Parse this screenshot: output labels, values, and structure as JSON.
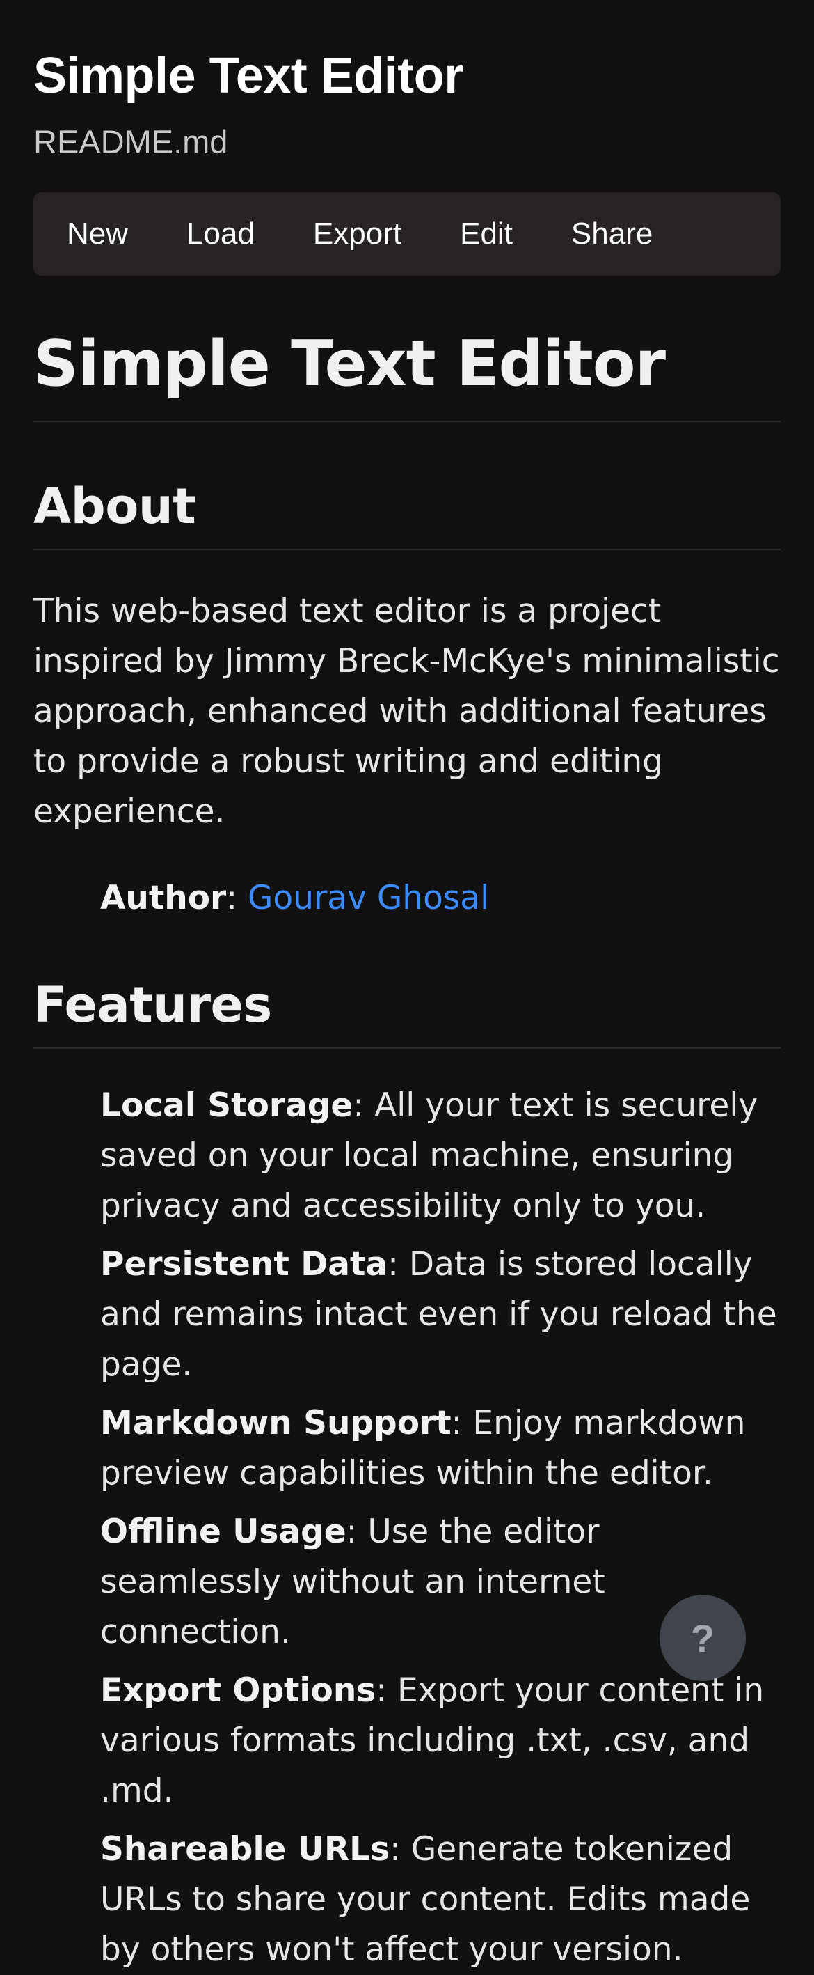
{
  "app": {
    "title": "Simple Text Editor",
    "filename": "README.md"
  },
  "toolbar": {
    "items": [
      {
        "label": "New"
      },
      {
        "label": "Load"
      },
      {
        "label": "Export"
      },
      {
        "label": "Edit"
      },
      {
        "label": "Share"
      }
    ]
  },
  "document": {
    "h1": "Simple Text Editor",
    "about": {
      "heading": "About",
      "paragraph": "This web-based text editor is a project inspired by Jimmy Breck-McKye's minimalistic approach, enhanced with additional features to provide a robust writing and editing experience.",
      "author_label": "Author",
      "author_separator": ": ",
      "author_name": "Gourav Ghosal"
    },
    "features": {
      "heading": "Features",
      "items": [
        {
          "name": "Local Storage",
          "text": ": All your text is securely saved on your local machine, ensuring privacy and accessibility only to you."
        },
        {
          "name": "Persistent Data",
          "text": ": Data is stored locally and remains intact even if you reload the page."
        },
        {
          "name": "Markdown Support",
          "text": ": Enjoy markdown preview capabilities within the editor."
        },
        {
          "name": "Offline Usage",
          "text": ": Use the editor seamlessly without an internet connection."
        },
        {
          "name": "Export Options",
          "text": ": Export your content in various formats including .txt, .csv, and .md."
        },
        {
          "name": "Shareable URLs",
          "text": ": Generate tokenized URLs to share your content. Edits made by others won't affect your version."
        }
      ]
    }
  },
  "help_button": {
    "label": "?",
    "icon": "question-mark-icon"
  },
  "colors": {
    "background": "#111112",
    "toolbar_bg": "#282424",
    "link": "#3d8bfd",
    "text": "#e6e6e8"
  }
}
